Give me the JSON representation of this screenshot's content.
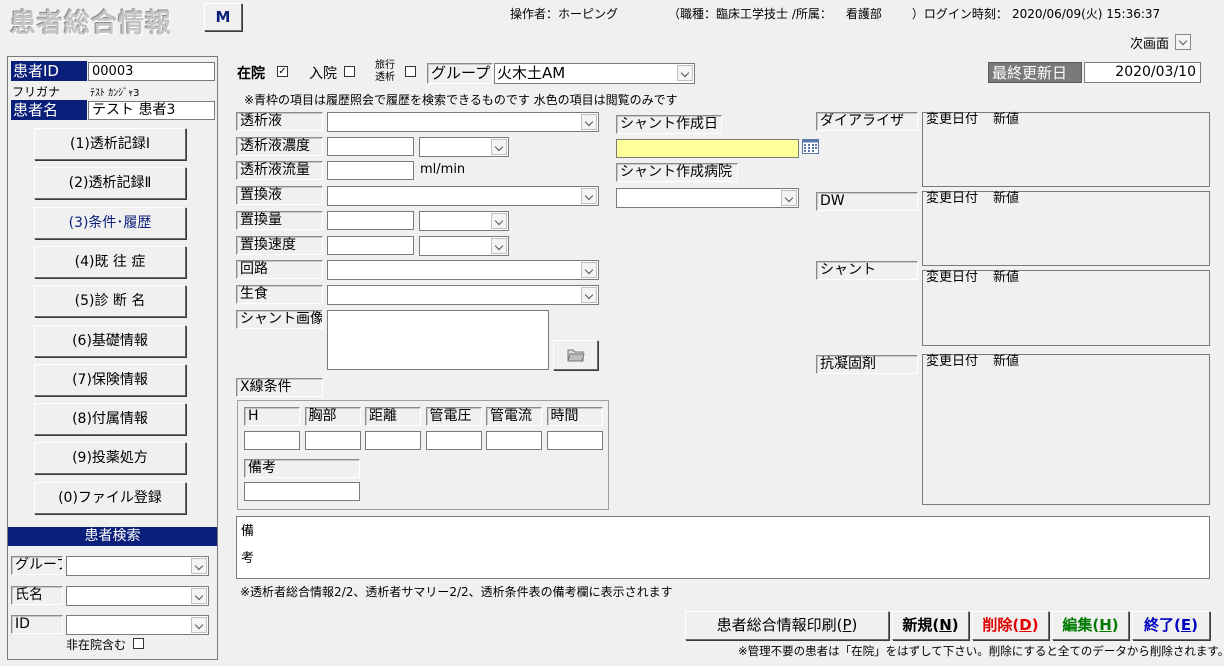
{
  "header": {
    "title": "患者総合情報",
    "m_button": "M",
    "operator_label": "操作者：",
    "operator": "ホーピング",
    "job_label": "（職種：",
    "job": "臨床工学技士",
    "dept_label": "/所属：",
    "dept": "看護部",
    "login_label": "）ログイン時刻：",
    "login_time": "2020/06/09(火) 15:36:37",
    "next_screen": "次画面"
  },
  "patient": {
    "id_label": "患者ID",
    "id": "00003",
    "furigana_label": "フリガナ",
    "furigana": "ﾃｽﾄ ｶﾝｼﾞｬ3",
    "name_label": "患者名",
    "name": "テスト 患者3"
  },
  "nav": {
    "items": [
      {
        "label": "(1)透析記録Ⅰ"
      },
      {
        "label": "(2)透析記録Ⅱ"
      },
      {
        "label": "(3)条件･履歴"
      },
      {
        "label": "(4)既 往 症"
      },
      {
        "label": "(5)診 断 名"
      },
      {
        "label": "(6)基礎情報"
      },
      {
        "label": "(7)保険情報"
      },
      {
        "label": "(8)付属情報"
      },
      {
        "label": "(9)投薬処方"
      },
      {
        "label": "(0)ファイル登録"
      }
    ]
  },
  "search": {
    "title": "患者検索",
    "group_label": "グループ",
    "name_label": "氏名",
    "id_label": "ID",
    "include_label": "非在院含む"
  },
  "status": {
    "zaiin": "在院",
    "zaiin_checked": "✓",
    "nyuin": "入院",
    "ryoko1": "旅行",
    "ryoko2": "透析",
    "group_label": "グループ",
    "group_value": "火木土AM",
    "last_updated_label": "最終更新日",
    "last_updated": "2020/03/10"
  },
  "notice": "※青枠の項目は履歴照会で履歴を検索できるものです 水色の項目は閲覧のみです",
  "form": {
    "dialysate": "透析液",
    "concentration": "透析液濃度",
    "flow": "透析液流量",
    "flow_unit": "ml/min",
    "replacement": "置換液",
    "replacement_vol": "置換量",
    "replacement_speed": "置換速度",
    "circuit": "回路",
    "saline": "生食",
    "shunt_image": "シャント画像",
    "shunt_date": "シャント作成日",
    "shunt_hospital": "シャント作成病院",
    "xray": "X線条件",
    "xray_cols": [
      "H",
      "胸部",
      "距離",
      "管電圧",
      "管電流",
      "時間"
    ],
    "xray_note": "備考"
  },
  "history": {
    "change_date": "変更日付",
    "new_value": "新値",
    "dialyzer": "ダイアライザ",
    "dw": "DW",
    "shunt": "シャント",
    "anticoag": "抗凝固剤"
  },
  "remarks": {
    "label1": "備",
    "label2": "考",
    "note": "※透析者総合情報2/2、透析者サマリー2/2、透析条件表の備考欄に表示されます"
  },
  "buttons": {
    "print": "患者総合情報印刷(",
    "print_key": "P",
    "new": "新規(",
    "new_key": "N",
    "delete": "削除(",
    "delete_key": "D",
    "edit": "編集(",
    "edit_key": "H",
    "exit": "終了(",
    "exit_key": "E",
    "close_paren": ")"
  },
  "footer_note": "※管理不要の患者は「在院」をはずして下さい。削除にすると全てのデータから削除されます。",
  "colors": {
    "navy": "#0a1f7a",
    "highlight_yellow": "#ffff99",
    "delete_red": "#e00000",
    "edit_green": "#007a00",
    "exit_blue": "#0000c0"
  }
}
